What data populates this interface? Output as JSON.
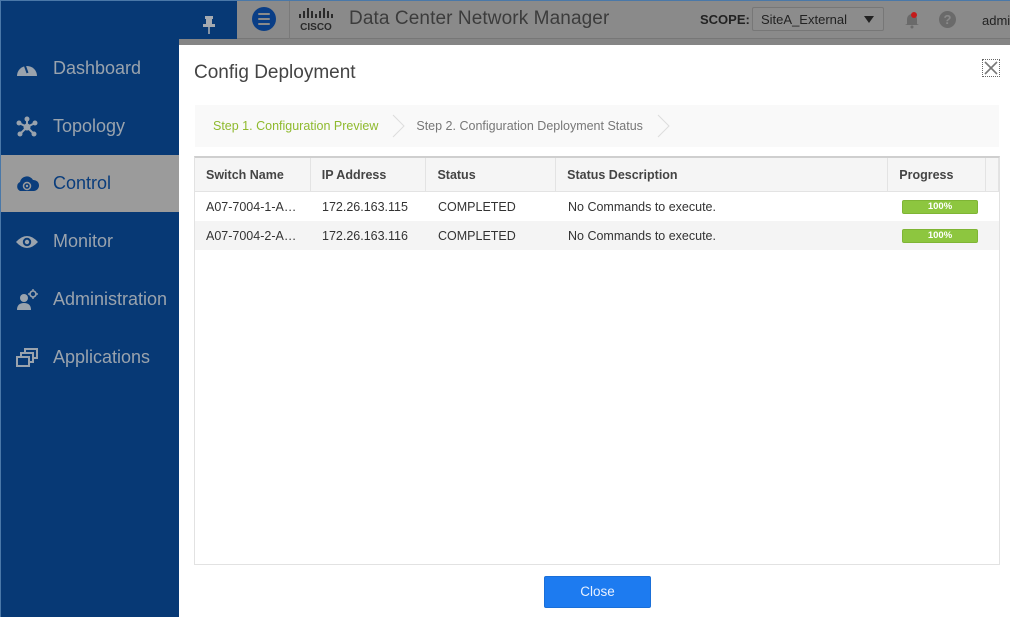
{
  "header": {
    "app_title": "Data Center Network Manager",
    "scope_label": "SCOPE:",
    "scope_value": "SiteA_External",
    "user": "admin",
    "help_glyph": "?"
  },
  "sidebar": {
    "items": [
      {
        "label": "Dashboard",
        "icon": "dashboard-gauge-icon"
      },
      {
        "label": "Topology",
        "icon": "topology-icon"
      },
      {
        "label": "Control",
        "icon": "control-cloud-icon",
        "active": true
      },
      {
        "label": "Monitor",
        "icon": "eye-icon"
      },
      {
        "label": "Administration",
        "icon": "admin-user-gear-icon"
      },
      {
        "label": "Applications",
        "icon": "applications-windows-icon"
      }
    ]
  },
  "modal": {
    "title": "Config Deployment",
    "steps": [
      {
        "label": "Step 1. Configuration Preview",
        "state": "current"
      },
      {
        "label": "Step 2. Configuration Deployment Status",
        "state": "next"
      }
    ],
    "table": {
      "columns": [
        "Switch Name",
        "IP Address",
        "Status",
        "Status Description",
        "Progress"
      ],
      "rows": [
        {
          "switch_name": "A07-7004-1-A…",
          "ip": "172.26.163.115",
          "status": "COMPLETED",
          "description": "No Commands to execute.",
          "progress_label": "100%",
          "progress_percent": 100
        },
        {
          "switch_name": "A07-7004-2-A…",
          "ip": "172.26.163.116",
          "status": "COMPLETED",
          "description": "No Commands to execute.",
          "progress_label": "100%",
          "progress_percent": 100
        }
      ]
    },
    "close_label": "Close"
  },
  "colors": {
    "sidebar_bg": "#073975",
    "step_active": "#8fba2e",
    "progress_green": "#8dc63f",
    "primary_button": "#1d7bf0"
  }
}
